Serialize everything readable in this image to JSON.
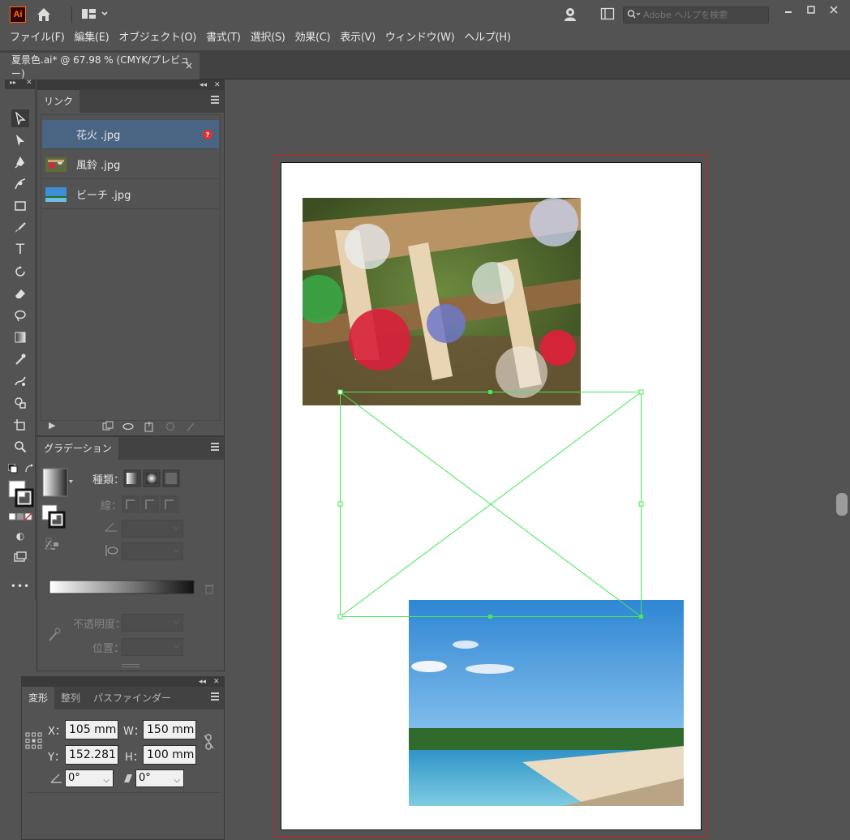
{
  "app": {
    "logo": "Ai",
    "search_placeholder": "Adobe ヘルプを検索"
  },
  "menu": [
    "ファイル(F)",
    "編集(E)",
    "オブジェクト(O)",
    "書式(T)",
    "選択(S)",
    "効果(C)",
    "表示(V)",
    "ウィンドウ(W)",
    "ヘルプ(H)"
  ],
  "document_tab": {
    "title": "夏景色.ai* @ 67.98 % (CMYK/プレビュー)",
    "close": "×"
  },
  "links_panel": {
    "tab": "リンク",
    "items": [
      {
        "name": "花火 .jpg",
        "missing": true
      },
      {
        "name": "風鈴 .jpg",
        "missing": false
      },
      {
        "name": "ビーチ .jpg",
        "missing": false
      }
    ],
    "missing_badge": "?"
  },
  "gradient_panel": {
    "tab": "グラデーション",
    "type_label": "種類：",
    "stroke_label": "線：",
    "opacity_label": "不透明度：",
    "position_label": "位置："
  },
  "transform_panel": {
    "tabs": [
      "変形",
      "整列",
      "パスファインダー"
    ],
    "x_label": "X：",
    "x_value": "105 mm",
    "y_label": "Y：",
    "y_value": "152.281 mm",
    "w_label": "W：",
    "w_value": "150 mm",
    "h_label": "H：",
    "h_value": "100 mm",
    "rotate_value": "0°",
    "shear_value": "0°"
  },
  "colors": {
    "bg": "#535353",
    "selection": "#4a6584",
    "bleed": "#d31e1e",
    "frame": "#44e855"
  }
}
